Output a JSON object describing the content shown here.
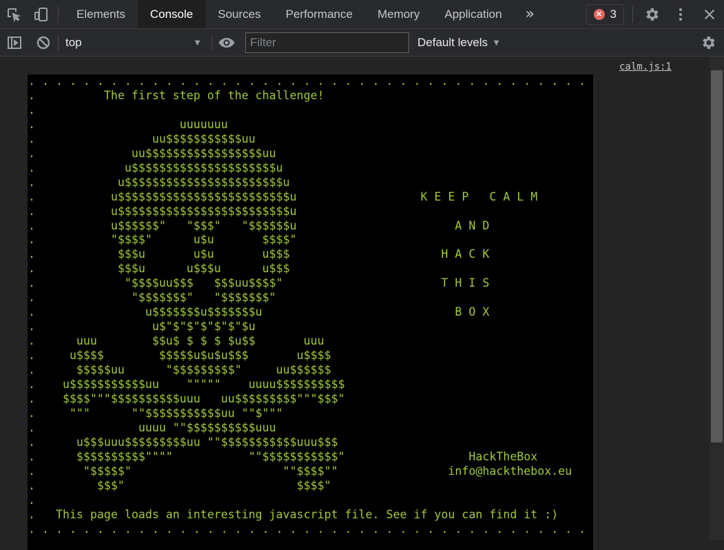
{
  "tabs": {
    "elements": "Elements",
    "console": "Console",
    "sources": "Sources",
    "performance": "Performance",
    "memory": "Memory",
    "application": "Application",
    "more": "»"
  },
  "error_count": "3",
  "toolbar": {
    "context": "top",
    "filter_placeholder": "Filter",
    "levels": "Default levels"
  },
  "message": {
    "source": "calm.js:1",
    "ascii_lines": [
      ". . . . . . . . . . . . . . . . . . . . . . . . . . . . . . . . . . . . . . . . . .",
      ".          The first step of the challenge!                                        .",
      ".                                                                                  .",
      ".                     uuuuuuu                                                      .",
      ".                 uu$$$$$$$$$$$uu                                                  .",
      ".              uu$$$$$$$$$$$$$$$$$uu                                               .",
      ".             u$$$$$$$$$$$$$$$$$$$$$u                                              .",
      ".            u$$$$$$$$$$$$$$$$$$$$$$$u                                             .",
      ".           u$$$$$$$$$$$$$$$$$$$$$$$$$u                  K E E P   C A L M         .",
      ".           u$$$$$$$$$$$$$$$$$$$$$$$$$u                                            .",
      ".           u$$$$$$\"   \"$$$\"   \"$$$$$$u                       A N D                .",
      ".           \"$$$$\"      u$u       $$$$\"                                            .",
      ".            $$$u       u$u       u$$$                      H A C K                .",
      ".            $$$u      u$$$u      u$$$                                             .",
      ".             \"$$$$uu$$$   $$$uu$$$$\"                       T H I S                .",
      ".              \"$$$$$$$\"   \"$$$$$$$\"                                               .",
      ".                u$$$$$$$u$$$$$$$u                            B O X                .",
      ".                 u$\"$\"$\"$\"$\"$\"$u                                                  .",
      ".      uuu        $$u$ $ $ $ $u$$       uuu                                        .",
      ".     u$$$$        $$$$$u$u$u$$$       u$$$$                                       .",
      ".      $$$$$uu      \"$$$$$$$$$\"     uu$$$$$$                                       .",
      ".    u$$$$$$$$$$$uu    \"\"\"\"\"    uuuu$$$$$$$$$$                                     .",
      ".    $$$$\"\"\"$$$$$$$$$$uuu   uu$$$$$$$$$\"\"\"$$$\"                                     .",
      ".     \"\"\"      \"\"$$$$$$$$$$$uu \"\"$\"\"\"                                              .",
      ".               uuuu \"\"$$$$$$$$$$uuu                                                .",
      ".      u$$$uuu$$$$$$$$$uu \"\"$$$$$$$$$$$uuu$$$                                      .",
      ".      $$$$$$$$$$\"\"\"\"           \"\"$$$$$$$$$$$\"                  HackTheBox         .",
      ".       \"$$$$$\"                      \"\"$$$$\"\"                info@hackthebox.eu    .",
      ".         $$$\"                         $$$$\"                                       .",
      ".                                                                                  .",
      ".   This page loads an interesting javascript file. See if you can find it :)     .",
      ". . . . . . . . . . . . . . . . . . . . . . . . . . . . . . . . . . . . . . . . . ."
    ]
  },
  "icons": {
    "inspect": "select-element-icon",
    "device": "device-toolbar-icon",
    "error": "error-icon",
    "settings": "gear-icon",
    "menu": "kebab-menu-icon",
    "close": "close-icon",
    "sidebar": "sidebar-toggle-icon",
    "clear": "clear-console-icon",
    "eye": "live-expression-icon"
  }
}
